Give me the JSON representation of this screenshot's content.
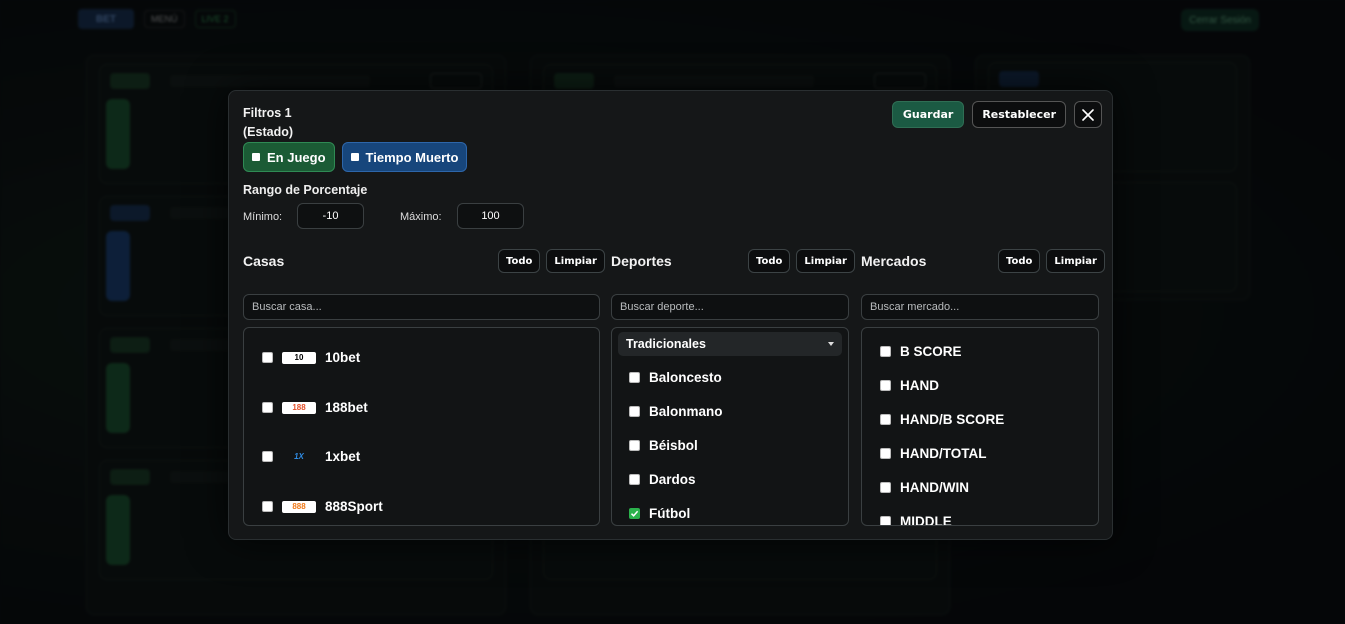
{
  "background": {
    "menu_label": "MENÚ",
    "live_label": "LIVE 2",
    "logout_label": "Cerrar Sesión"
  },
  "modal": {
    "title": "Filtros 1",
    "subtitle": "(Estado)",
    "save_label": "Guardar",
    "reset_label": "Restablecer",
    "states": [
      {
        "label": "En Juego",
        "color": "#1b5b35"
      },
      {
        "label": "Tiempo Muerto",
        "color": "#17467c"
      }
    ],
    "range": {
      "title": "Rango de Porcentaje",
      "min_label": "Mínimo:",
      "min_value": "-10",
      "max_label": "Máximo:",
      "max_value": "100"
    },
    "casas": {
      "title": "Casas",
      "all_label": "Todo",
      "clear_label": "Limpiar",
      "search_placeholder": "Buscar casa...",
      "items": [
        {
          "label": "10bet",
          "logo": "10bet-logo"
        },
        {
          "label": "188bet",
          "logo": "188bet-logo"
        },
        {
          "label": "1xbet",
          "logo": "1xbet-logo"
        },
        {
          "label": "888Sport",
          "logo": "888sport-logo"
        }
      ]
    },
    "deportes": {
      "title": "Deportes",
      "all_label": "Todo",
      "clear_label": "Limpiar",
      "search_placeholder": "Buscar deporte...",
      "group": "Tradicionales",
      "items": [
        {
          "label": "Baloncesto",
          "checked": false
        },
        {
          "label": "Balonmano",
          "checked": false
        },
        {
          "label": "Béisbol",
          "checked": false
        },
        {
          "label": "Dardos",
          "checked": false
        },
        {
          "label": "Fútbol",
          "checked": true
        }
      ]
    },
    "mercados": {
      "title": "Mercados",
      "all_label": "Todo",
      "clear_label": "Limpiar",
      "search_placeholder": "Buscar mercado...",
      "items": [
        {
          "label": "B SCORE"
        },
        {
          "label": "HAND"
        },
        {
          "label": "HAND/B SCORE"
        },
        {
          "label": "HAND/TOTAL"
        },
        {
          "label": "HAND/WIN"
        },
        {
          "label": "MIDDLE"
        }
      ]
    },
    "colors": {
      "accent_green": "#1b5a43",
      "check_green": "#2bb24c",
      "accent_blue": "#17467c"
    }
  }
}
